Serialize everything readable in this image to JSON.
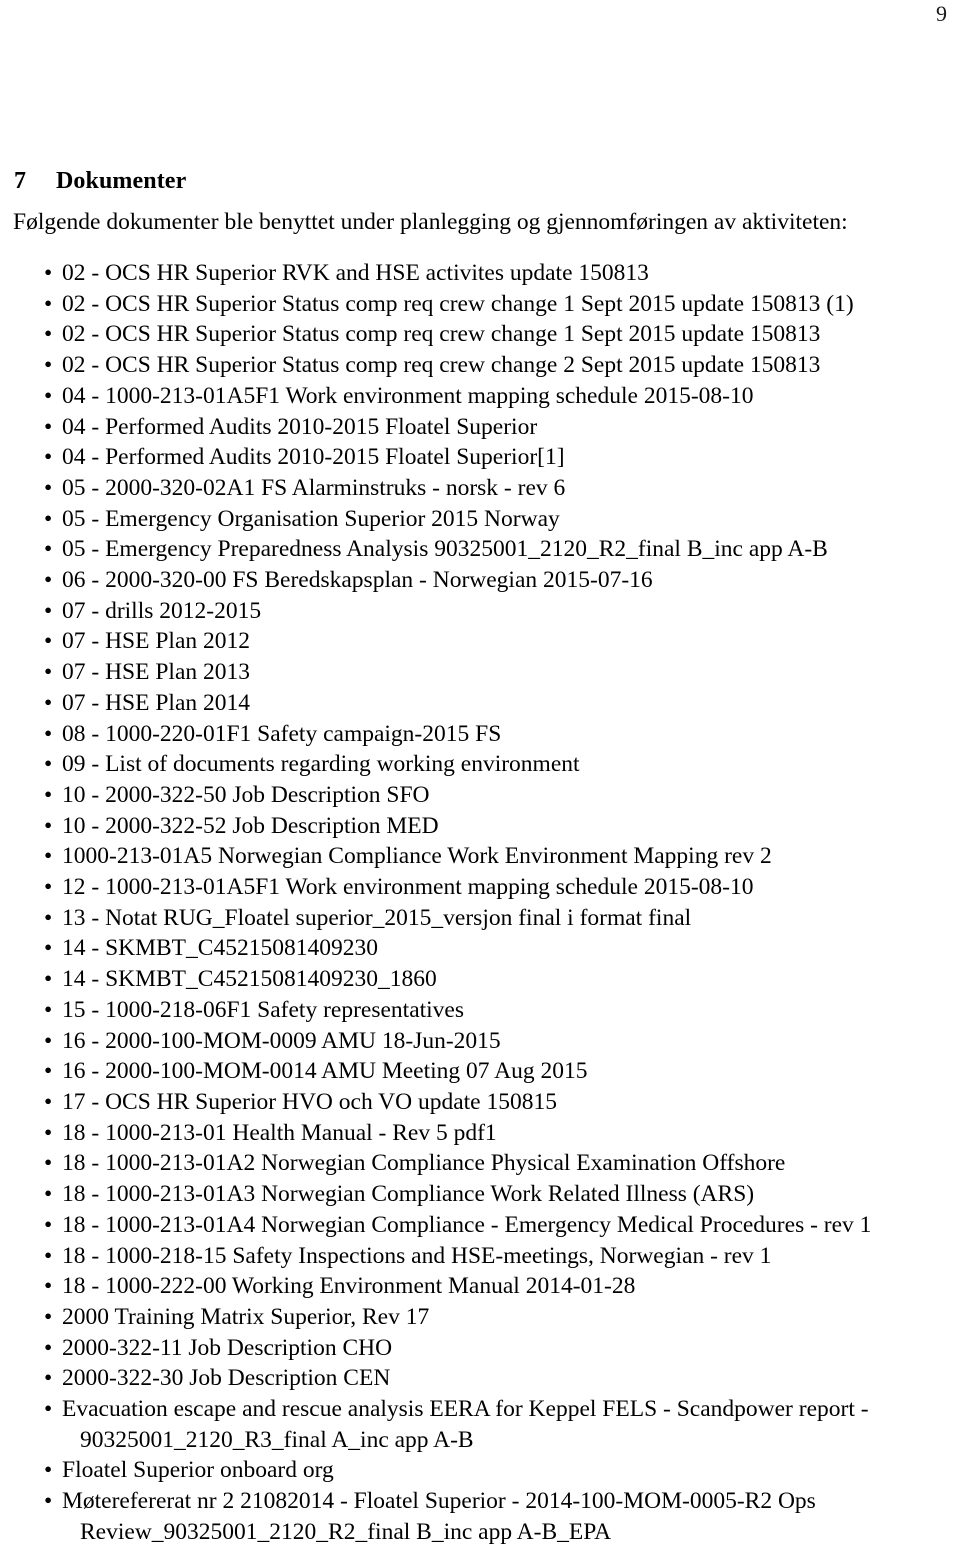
{
  "page": {
    "number": "9"
  },
  "heading": {
    "number": "7",
    "title": "Dokumenter"
  },
  "intro": {
    "text": "Følgende dokumenter ble benyttet under planlegging og gjennomføringen av aktiviteten:"
  },
  "list": {
    "bullet_glyph": "•",
    "items": [
      "02 - OCS HR Superior RVK and HSE activites update 150813",
      "02 - OCS HR Superior Status comp req crew change 1 Sept 2015 update 150813 (1)",
      "02 - OCS HR Superior Status comp req crew change 1 Sept 2015 update 150813",
      "02 - OCS HR Superior Status comp req crew change 2 Sept 2015 update 150813",
      "04 - 1000-213-01A5F1 Work environment mapping schedule 2015-08-10",
      "04 - Performed Audits 2010-2015 Floatel Superior",
      "04 - Performed Audits 2010-2015 Floatel Superior[1]",
      "05 - 2000-320-02A1 FS Alarminstruks - norsk - rev 6",
      "05 - Emergency Organisation Superior 2015 Norway",
      "05 - Emergency Preparedness Analysis 90325001_2120_R2_final B_inc app A-B",
      "06 - 2000-320-00 FS Beredskapsplan - Norwegian 2015-07-16",
      "07 - drills 2012-2015",
      "07 - HSE Plan 2012",
      "07 - HSE Plan 2013",
      "07 - HSE Plan 2014",
      "08 - 1000-220-01F1 Safety campaign-2015 FS",
      "09 - List of documents regarding working environment",
      "10 - 2000-322-50 Job Description SFO",
      "10 - 2000-322-52 Job Description MED",
      "1000-213-01A5 Norwegian Compliance Work Environment Mapping rev 2",
      "12 - 1000-213-01A5F1 Work environment mapping schedule 2015-08-10",
      "13 - Notat RUG_Floatel superior_2015_versjon final i format final",
      "14 - SKMBT_C45215081409230",
      "14 - SKMBT_C45215081409230_1860",
      "15 - 1000-218-06F1 Safety representatives",
      "16 - 2000-100-MOM-0009 AMU 18-Jun-2015",
      "16 - 2000-100-MOM-0014 AMU Meeting 07 Aug 2015",
      "17 - OCS HR Superior HVO och VO update 150815",
      "18 - 1000-213-01 Health Manual - Rev 5 pdf1",
      "18 - 1000-213-01A2 Norwegian Compliance Physical Examination Offshore",
      "18 - 1000-213-01A3 Norwegian Compliance Work Related Illness (ARS)",
      "18 - 1000-213-01A4 Norwegian Compliance - Emergency Medical Procedures - rev 1",
      "18 - 1000-218-15 Safety Inspections and HSE-meetings, Norwegian - rev 1",
      "18 - 1000-222-00 Working Environment Manual 2014-01-28",
      "2000 Training Matrix Superior, Rev 17",
      "2000-322-11 Job Description CHO",
      "2000-322-30 Job Description CEN",
      "Evacuation escape and rescue analysis EERA for Keppel FELS - Scandpower report - 90325001_2120_R3_final A_inc app A-B",
      "Floatel Superior onboard org",
      "Møterefererat nr 2 21082014 - Floatel Superior - 2014-100-MOM-0005-R2 Ops Review_90325001_2120_R2_final B_inc app A-B_EPA"
    ]
  }
}
